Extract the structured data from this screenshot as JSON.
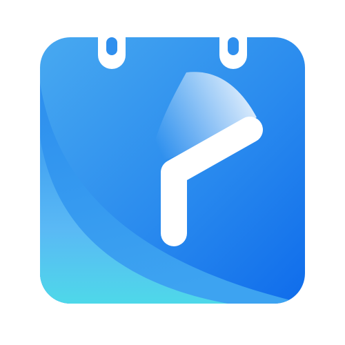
{
  "icon": {
    "name": "calendar-clock-app-icon",
    "colors": {
      "background": "#ffffff",
      "body_dark": "#1774ec",
      "body_mid": "#2f90ee",
      "body_light": "#45a6f0",
      "fold_light": "#62c0f6",
      "fold_teal": "#4fd6e8",
      "hand": "#ffffff",
      "ring": "#ffffff"
    }
  }
}
